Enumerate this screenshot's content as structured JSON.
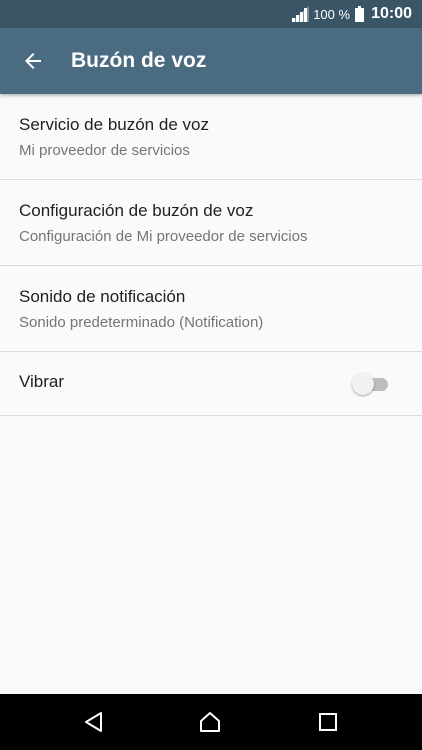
{
  "status_bar": {
    "battery_percent": "100 %",
    "time": "10:00",
    "icons": [
      "signal-icon",
      "battery-icon"
    ]
  },
  "app_bar": {
    "title": "Buzón de voz",
    "back_icon": "arrow-left-icon"
  },
  "settings": [
    {
      "title": "Servicio de buzón de voz",
      "summary": "Mi proveedor de servicios"
    },
    {
      "title": "Configuración de buzón de voz",
      "summary": "Configuración de Mi proveedor de servicios"
    },
    {
      "title": "Sonido de notificación",
      "summary": "Sonido predeterminado (Notification)"
    },
    {
      "title": "Vibrar",
      "toggle_on": false
    }
  ],
  "nav_bar": {
    "icons": [
      "back-triangle-icon",
      "home-icon",
      "recents-icon"
    ]
  },
  "colors": {
    "status_bar": "#395566",
    "app_bar": "#4a6b80",
    "background": "#fafafa",
    "primary_text": "#212121",
    "secondary_text": "#757575",
    "divider": "#dcdcdc"
  }
}
